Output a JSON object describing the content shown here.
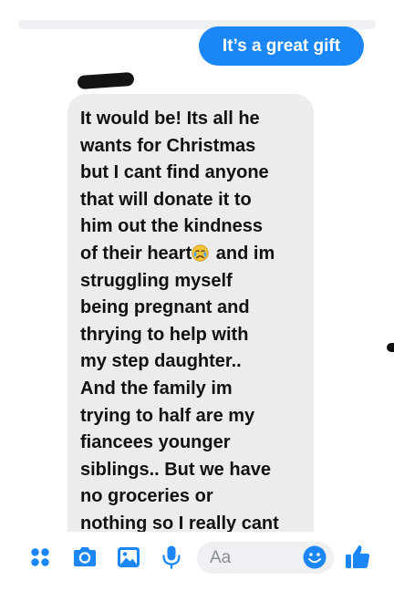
{
  "thread": {
    "sent_message": "It’s a great gift",
    "received_message_lines": [
      "It would be! Its all he",
      "wants for Christmas",
      "but I cant find anyone",
      "that will donate it to",
      "him out the kindness",
      "of their heart",
      " and im",
      "struggling myself",
      "being pregnant and",
      "thrying to help with",
      "my step daughter..",
      "And the family im",
      "trying to half are my",
      "fiancees younger",
      "siblings.. But we have",
      "no groceries or",
      "nothing so I really cant"
    ],
    "inline_emoji": "crying-face-icon"
  },
  "composer": {
    "placeholder": "Aa",
    "icons": [
      "more-apps-icon",
      "camera-icon",
      "gallery-icon",
      "microphone-icon",
      "emoji-icon",
      "like-thumb-icon"
    ]
  },
  "colors": {
    "accent": "#1b86f5",
    "received_bubble": "#ececec",
    "input_bg": "#eef0f3"
  }
}
